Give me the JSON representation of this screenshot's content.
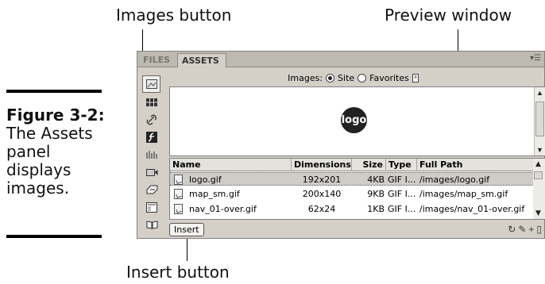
{
  "callouts": {
    "images_button": "Images button",
    "preview_window": "Preview window",
    "insert_button": "Insert button"
  },
  "caption": {
    "figure_number": "Figure 3-2:",
    "text": "The Assets panel displays images."
  },
  "panel": {
    "tabs": [
      "FILES",
      "ASSETS"
    ],
    "options_icon": "panel-options-icon",
    "toolbar": {
      "label": "Images:",
      "options": [
        {
          "label": "Site",
          "selected": true
        },
        {
          "label": "Favorites",
          "selected": false
        }
      ]
    },
    "sidebar_icons": [
      "images-icon",
      "colors-icon",
      "urls-icon",
      "flash-icon",
      "shockwave-icon",
      "movies-icon",
      "scripts-icon",
      "templates-icon",
      "library-icon"
    ],
    "preview": {
      "logo_text": "logo"
    },
    "table": {
      "columns": [
        "Name",
        "Dimensions",
        "Size",
        "Type",
        "Full Path"
      ],
      "rows": [
        {
          "name": "logo.gif",
          "dimensions": "192x201",
          "size": "4KB",
          "type": "GIF I...",
          "path": "/images/logo.gif",
          "selected": true
        },
        {
          "name": "map_sm.gif",
          "dimensions": "200x140",
          "size": "9KB",
          "type": "GIF I...",
          "path": "/images/map_sm.gif",
          "selected": false
        },
        {
          "name": "nav_01-over.gif",
          "dimensions": "62x24",
          "size": "1KB",
          "type": "GIF I...",
          "path": "/images/nav_01-over.gif",
          "selected": false
        }
      ]
    },
    "insert_label": "Insert",
    "bottom_icons": [
      "refresh-icon",
      "edit-icon",
      "add-to-favorites-icon"
    ]
  }
}
